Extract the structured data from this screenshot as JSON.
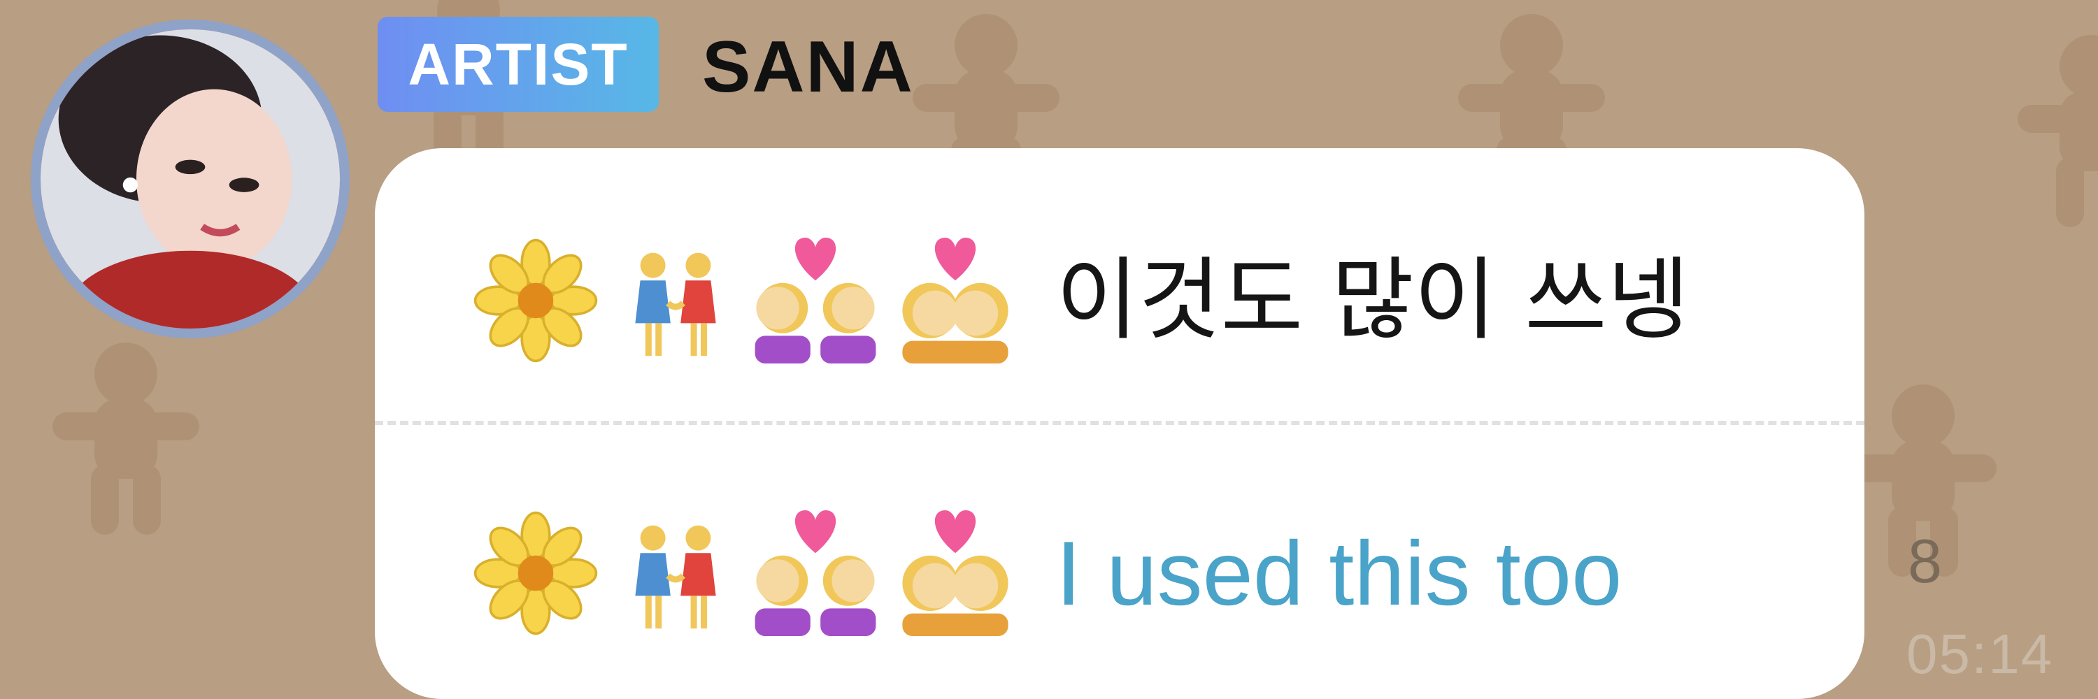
{
  "sender": {
    "badge": "ARTIST",
    "name": "SANA"
  },
  "message": {
    "original": {
      "emojis": [
        "blossom-emoji",
        "two-women-holding-hands-emoji",
        "couple-with-heart-women-emoji",
        "kiss-women-emoji"
      ],
      "text": "이것도 많이 쓰넹"
    },
    "translation": {
      "emojis": [
        "blossom-emoji",
        "two-women-holding-hands-emoji",
        "couple-with-heart-women-emoji",
        "kiss-women-emoji"
      ],
      "text": "I used this too"
    }
  },
  "meta": {
    "unread_count": "8",
    "time": "05:14"
  },
  "colors": {
    "background": "#b89e82",
    "badge_gradient_start": "#6f8ef2",
    "badge_gradient_end": "#57b8e6",
    "translation_text": "#4aa3c9",
    "avatar_ring": "#8fa2c8"
  },
  "icons": {
    "wallpaper": "gingerbread-man-icon",
    "avatar": "profile-avatar"
  }
}
